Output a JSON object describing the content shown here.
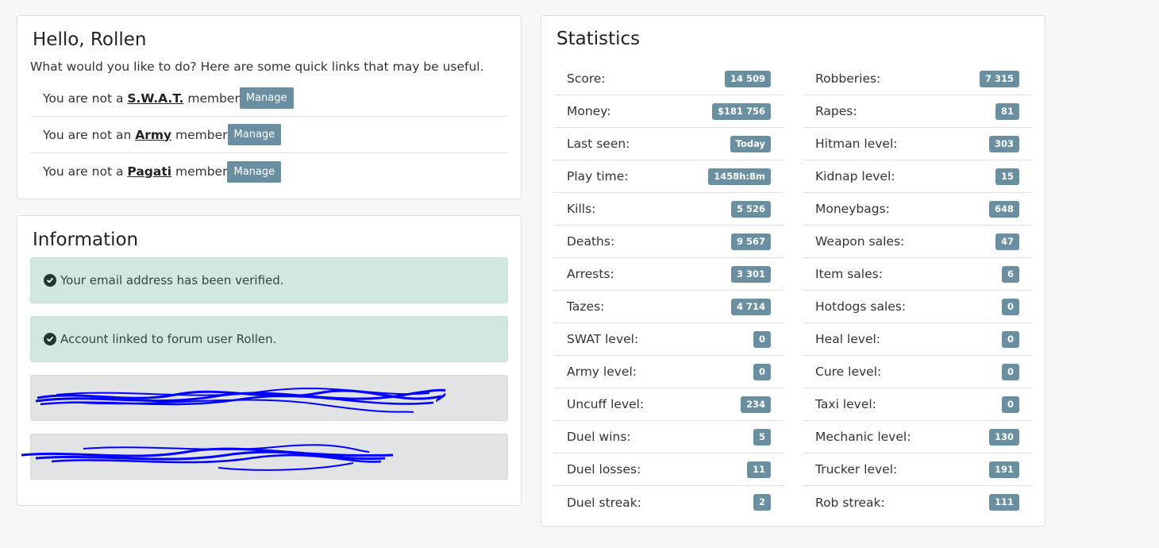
{
  "hello": {
    "title": "Hello, Rollen",
    "intro": "What would you like to do? Here are some quick links that may be useful.",
    "memberships": [
      {
        "prefix": "You are not a ",
        "group": "S.W.A.T.",
        "suffix": " member",
        "button": "Manage"
      },
      {
        "prefix": "You are not an ",
        "group": "Army",
        "suffix": " member",
        "button": "Manage"
      },
      {
        "prefix": "You are not a ",
        "group": "Pagati",
        "suffix": " member",
        "button": "Manage"
      }
    ]
  },
  "information": {
    "title": "Information",
    "alerts": [
      {
        "text": "Your email address has been verified.",
        "icon": "check-circle-icon"
      },
      {
        "text": "Account linked to forum user Rollen.",
        "icon": "check-circle-icon"
      }
    ],
    "redacted_alerts": 2
  },
  "statistics": {
    "title": "Statistics",
    "left": [
      {
        "label": "Score:",
        "value": "14 509"
      },
      {
        "label": "Money:",
        "value": "$181 756"
      },
      {
        "label": "Last seen:",
        "value": "Today"
      },
      {
        "label": "Play time:",
        "value": "1458h:8m"
      },
      {
        "label": "Kills:",
        "value": "5 526"
      },
      {
        "label": "Deaths:",
        "value": "9 567"
      },
      {
        "label": "Arrests:",
        "value": "3 301"
      },
      {
        "label": "Tazes:",
        "value": "4 714"
      },
      {
        "label": "SWAT level:",
        "value": "0"
      },
      {
        "label": "Army level:",
        "value": "0"
      },
      {
        "label": "Uncuff level:",
        "value": "234"
      },
      {
        "label": "Duel wins:",
        "value": "5"
      },
      {
        "label": "Duel losses:",
        "value": "11"
      },
      {
        "label": "Duel streak:",
        "value": "2"
      }
    ],
    "right": [
      {
        "label": "Robberies:",
        "value": "7 315"
      },
      {
        "label": "Rapes:",
        "value": "81"
      },
      {
        "label": "Hitman level:",
        "value": "303"
      },
      {
        "label": "Kidnap level:",
        "value": "15"
      },
      {
        "label": "Moneybags:",
        "value": "648"
      },
      {
        "label": "Weapon sales:",
        "value": "47"
      },
      {
        "label": "Item sales:",
        "value": "6"
      },
      {
        "label": "Hotdogs sales:",
        "value": "0"
      },
      {
        "label": "Heal level:",
        "value": "0"
      },
      {
        "label": "Cure level:",
        "value": "0"
      },
      {
        "label": "Taxi level:",
        "value": "0"
      },
      {
        "label": "Mechanic level:",
        "value": "130"
      },
      {
        "label": "Trucker level:",
        "value": "191"
      },
      {
        "label": "Rob streak:",
        "value": "111"
      }
    ]
  },
  "colors": {
    "badge": "#6a8fa0",
    "alert_success_bg": "#d1e8de",
    "alert_neutral_bg": "#e2e3e5",
    "redaction_ink": "#0000ff"
  }
}
